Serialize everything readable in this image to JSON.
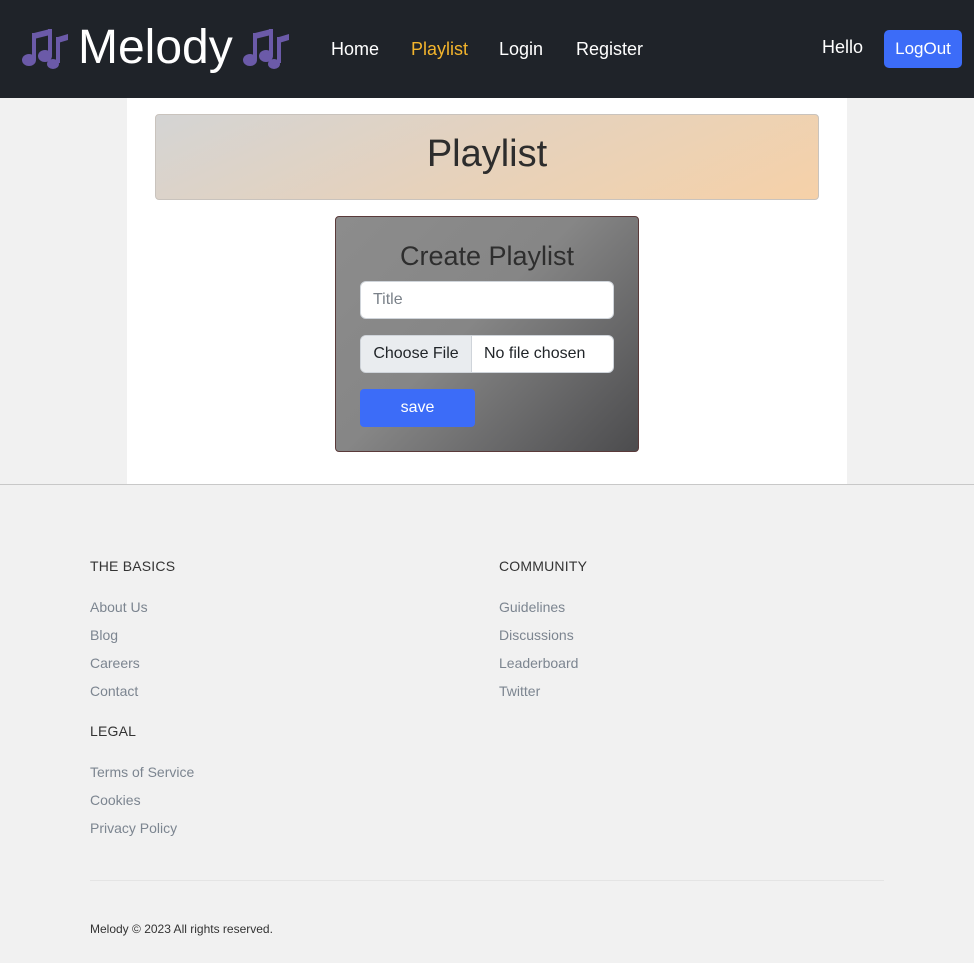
{
  "navbar": {
    "brand": "Melody",
    "links": [
      {
        "label": "Home"
      },
      {
        "label": "Playlist"
      },
      {
        "label": "Login"
      },
      {
        "label": "Register"
      }
    ],
    "greeting": "Hello",
    "logout_label": "LogOut",
    "active_color": "#f3b42c",
    "icon": "music-notes-icon",
    "icon_color": "#6b5aa8"
  },
  "banner": {
    "title": "Playlist"
  },
  "form": {
    "heading": "Create Playlist",
    "title_placeholder": "Title",
    "title_value": "",
    "file_button_label": "Choose File",
    "file_status": "No file chosen",
    "save_label": "save",
    "accent_color": "#3c6cf8"
  },
  "footer": {
    "basics": {
      "heading": "THE BASICS",
      "links": [
        "About Us",
        "Blog",
        "Careers",
        "Contact"
      ]
    },
    "community": {
      "heading": "COMMUNITY",
      "links": [
        "Guidelines",
        "Discussions",
        "Leaderboard",
        "Twitter"
      ]
    },
    "legal": {
      "heading": "LEGAL",
      "links": [
        "Terms of Service",
        "Cookies",
        "Privacy Policy"
      ]
    },
    "copyright": "Melody © 2023 All rights reserved."
  }
}
